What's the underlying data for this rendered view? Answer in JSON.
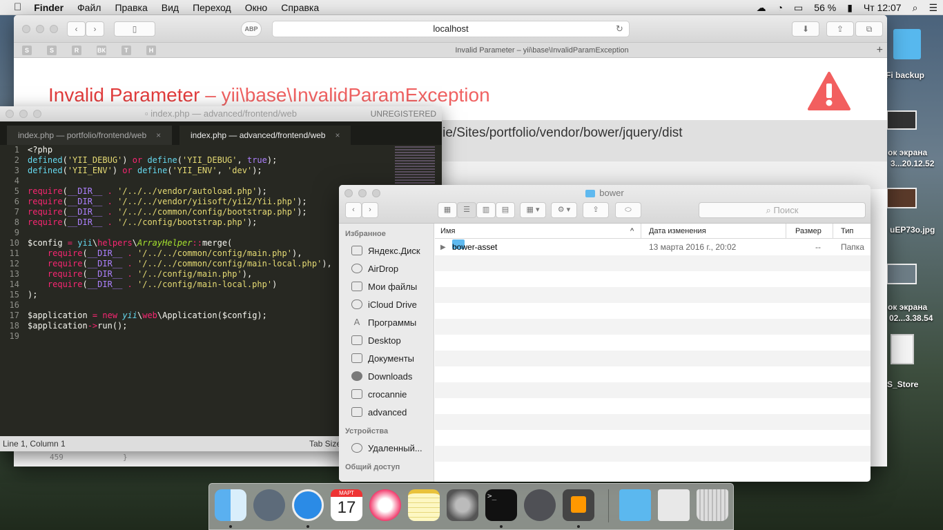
{
  "menubar": {
    "apple": "",
    "app": "Finder",
    "items": [
      "Файл",
      "Правка",
      "Вид",
      "Переход",
      "Окно",
      "Справка"
    ],
    "battery": "56 %",
    "clock": "Чт 12:07"
  },
  "desktop": {
    "labels": [
      "Fi backup",
      "ок экрана",
      "3...20.12.52",
      "uEP73o.jpg",
      "ок экрана",
      "02...3.38.54",
      "S_Store"
    ]
  },
  "safari": {
    "url": "localhost",
    "tab_title": "Invalid Parameter – yii\\base\\InvalidParamException",
    "adblock": "ABP",
    "favorites": [
      "S",
      "S",
      "R",
      "ВК",
      "T",
      "H"
    ],
    "error_title": "Invalid Parameter",
    "error_subtitle": "– yii\\base\\InvalidParamException",
    "error_path": "nnie/Sites/portfolio/vendor/bower/jquery/dist",
    "line_number": "459",
    "line_code": "}"
  },
  "sublime": {
    "title": "index.php — advanced/frontend/web",
    "unregistered": "UNREGISTERED",
    "tabs": [
      "index.php — portfolio/frontend/web",
      "index.php — advanced/frontend/web"
    ],
    "status_left": "Line 1, Column 1",
    "status_right": "Tab Size",
    "line_numbers": [
      "1",
      "2",
      "3",
      "4",
      "5",
      "6",
      "7",
      "8",
      "9",
      "10",
      "11",
      "12",
      "13",
      "14",
      "15",
      "16",
      "17",
      "18",
      "19"
    ]
  },
  "finder": {
    "title": "bower",
    "search_placeholder": "Поиск",
    "favorites_header": "Избранное",
    "favorites": [
      "Яндекс.Диск",
      "AirDrop",
      "Мои файлы",
      "iCloud Drive",
      "Программы",
      "Desktop",
      "Документы",
      "Downloads",
      "crocannie",
      "advanced"
    ],
    "devices_header": "Устройства",
    "devices": [
      "Удаленный..."
    ],
    "shared_header": "Общий доступ",
    "columns": {
      "name": "Имя",
      "date": "Дата изменения",
      "size": "Размер",
      "kind": "Тип"
    },
    "rows": [
      {
        "name": "bower-asset",
        "date": "13 марта 2016 г., 20:02",
        "size": "--",
        "kind": "Папка"
      }
    ]
  },
  "dock": {
    "items": [
      "finder-icon",
      "launchpad-icon",
      "safari-icon",
      "calendar-icon",
      "itunes-icon",
      "notes-icon",
      "system-preferences-icon",
      "terminal-icon",
      "sequel-pro-icon",
      "sublime-text-icon",
      "folder-icon",
      "mamp-icon",
      "trash-icon"
    ],
    "calendar_month": "МАРТ",
    "calendar_day": "17"
  }
}
